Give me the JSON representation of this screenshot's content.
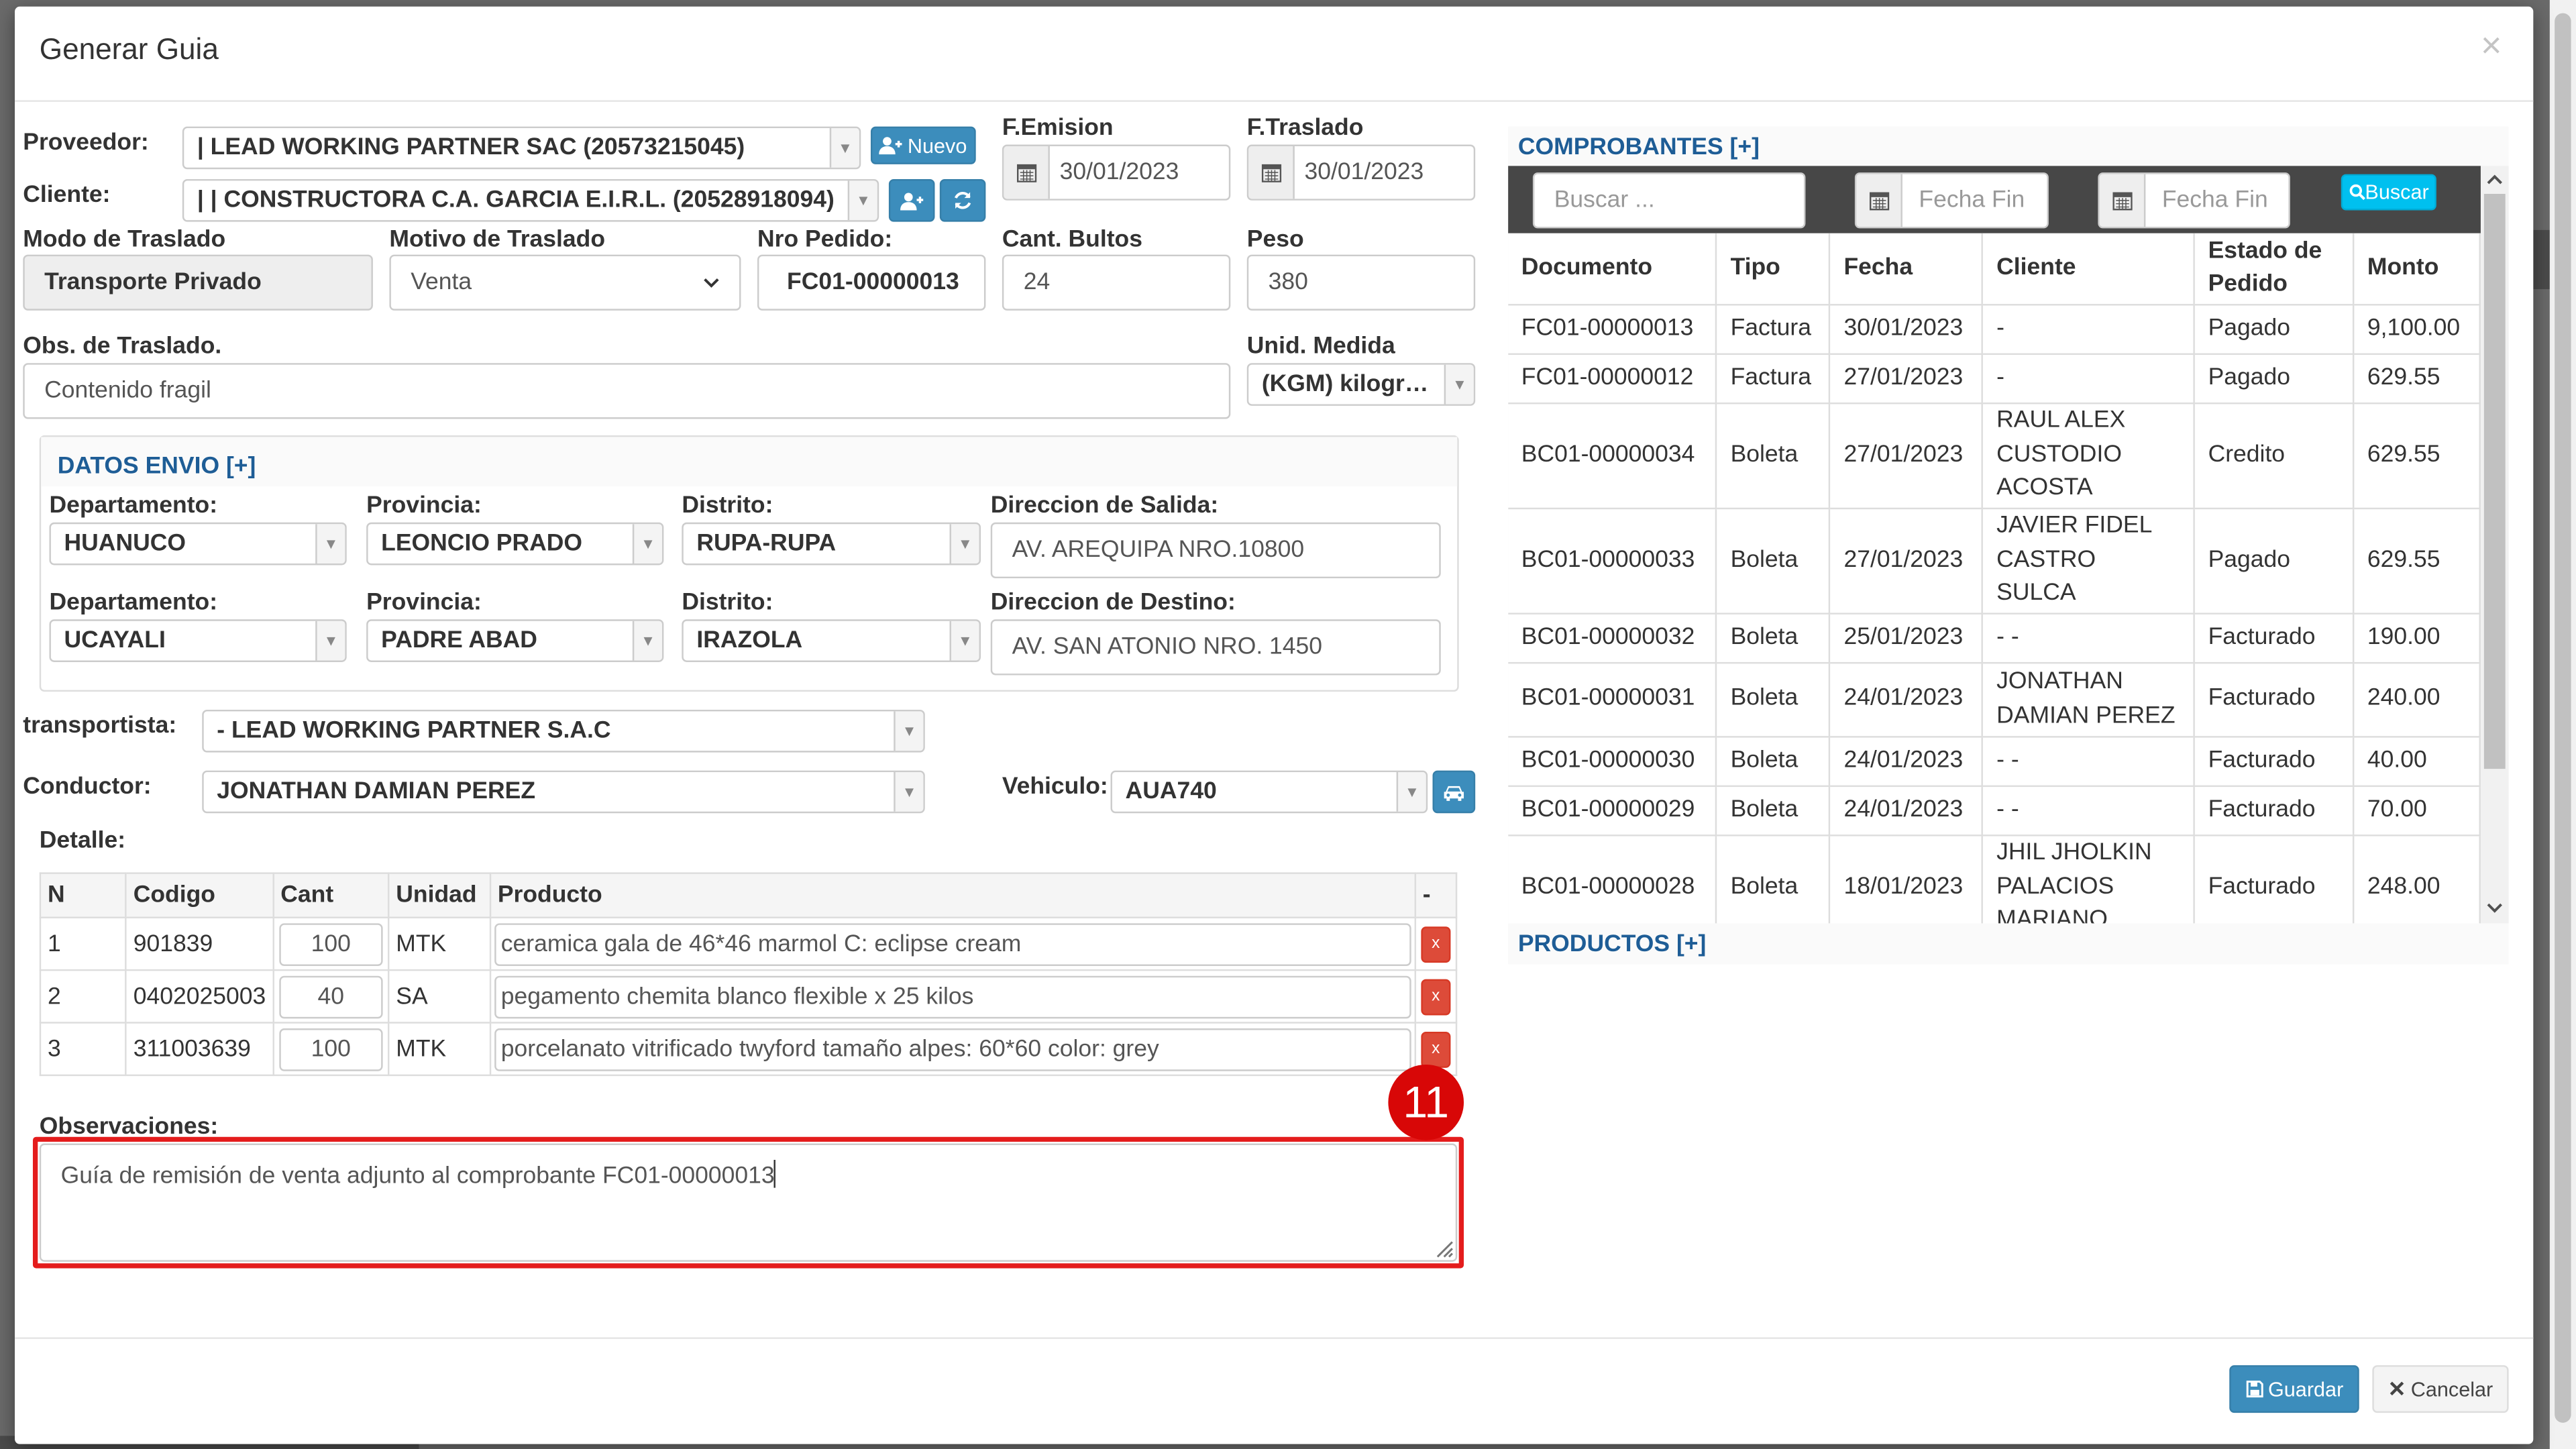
{
  "modal": {
    "title": "Generar Guia",
    "close": "×"
  },
  "form": {
    "proveedor": {
      "label": "Proveedor:",
      "value": "| LEAD WORKING PARTNER SAC (20573215045)",
      "nuevo": "Nuevo"
    },
    "cliente": {
      "label": "Cliente:",
      "value": "| | CONSTRUCTORA C.A. GARCIA E.I.R.L. (20528918094)"
    },
    "f_emision": {
      "label": "F.Emision",
      "value": "30/01/2023"
    },
    "f_traslado": {
      "label": "F.Traslado",
      "value": "30/01/2023"
    },
    "modo": {
      "label": "Modo de Traslado",
      "value": "Transporte Privado"
    },
    "motivo": {
      "label": "Motivo de Traslado",
      "value": "Venta"
    },
    "nro_pedido": {
      "label": "Nro Pedido:",
      "value": "FC01-00000013"
    },
    "bultos": {
      "label": "Cant. Bultos",
      "value": "24"
    },
    "peso": {
      "label": "Peso",
      "value": "380"
    },
    "obs_traslado": {
      "label": "Obs. de Traslado.",
      "value": "Contenido fragil"
    },
    "unidad": {
      "label": "Unid. Medida",
      "value": "(KGM) kilogr…"
    }
  },
  "envio": {
    "title": "DATOS ENVIO [+]",
    "dep_label": "Departamento:",
    "prov_label": "Provincia:",
    "dist_label": "Distrito:",
    "salida_label": "Direccion de Salida:",
    "destino_label": "Direccion de Destino:",
    "origen": {
      "dep": "HUANUCO",
      "prov": "LEONCIO PRADO",
      "dist": "RUPA-RUPA",
      "dir": "AV. AREQUIPA NRO.10800"
    },
    "destino": {
      "dep": "UCAYALI",
      "prov": "PADRE ABAD",
      "dist": "IRAZOLA",
      "dir": "AV. SAN ATONIO NRO. 1450"
    }
  },
  "transportista": {
    "label": "transportista:",
    "value": "- LEAD WORKING PARTNER S.A.C"
  },
  "conductor": {
    "label": "Conductor:",
    "value": "JONATHAN DAMIAN PEREZ"
  },
  "vehiculo": {
    "label": "Vehiculo:",
    "value": "AUA740"
  },
  "detalle": {
    "label": "Detalle:",
    "headers": [
      "N",
      "Codigo",
      "Cant",
      "Unidad",
      "Producto",
      "-"
    ],
    "rows": [
      {
        "n": "1",
        "codigo": "901839",
        "cant": "100",
        "unidad": "MTK",
        "producto": "ceramica gala de 46*46 marmol C: eclipse cream",
        "del": "x"
      },
      {
        "n": "2",
        "codigo": "0402025003",
        "cant": "40",
        "unidad": "SA",
        "producto": "pegamento chemita blanco flexible x 25 kilos",
        "del": "x"
      },
      {
        "n": "3",
        "codigo": "311003639",
        "cant": "100",
        "unidad": "MTK",
        "producto": "porcelanato vitrificado twyford tamaño alpes: 60*60 color: grey",
        "del": "x"
      }
    ]
  },
  "observaciones": {
    "label": "Observaciones:",
    "value": "Guía de remisión de venta adjunto al comprobante FC01-00000013"
  },
  "annotation": {
    "number": "11",
    "color": "#e41c1c"
  },
  "comprobantes": {
    "title": "COMPROBANTES [+]",
    "search_placeholder": "Buscar ...",
    "fecha1_placeholder": "Fecha Fin",
    "fecha2_placeholder": "Fecha Fin",
    "buscar": "Buscar",
    "headers": [
      "Documento",
      "Tipo",
      "Fecha",
      "Cliente",
      "Estado de Pedido",
      "Monto"
    ],
    "rows": [
      {
        "doc": "FC01-00000013",
        "tipo": "Factura",
        "fecha": "30/01/2023",
        "cliente": "-",
        "estado": "Pagado",
        "monto": "9,100.00"
      },
      {
        "doc": "FC01-00000012",
        "tipo": "Factura",
        "fecha": "27/01/2023",
        "cliente": "-",
        "estado": "Pagado",
        "monto": "629.55"
      },
      {
        "doc": "BC01-00000034",
        "tipo": "Boleta",
        "fecha": "27/01/2023",
        "cliente": "RAUL ALEX CUSTODIO ACOSTA",
        "estado": "Credito",
        "monto": "629.55"
      },
      {
        "doc": "BC01-00000033",
        "tipo": "Boleta",
        "fecha": "27/01/2023",
        "cliente": "JAVIER FIDEL CASTRO SULCA",
        "estado": "Pagado",
        "monto": "629.55"
      },
      {
        "doc": "BC01-00000032",
        "tipo": "Boleta",
        "fecha": "25/01/2023",
        "cliente": "- -",
        "estado": "Facturado",
        "monto": "190.00"
      },
      {
        "doc": "BC01-00000031",
        "tipo": "Boleta",
        "fecha": "24/01/2023",
        "cliente": "JONATHAN DAMIAN PEREZ",
        "estado": "Facturado",
        "monto": "240.00"
      },
      {
        "doc": "BC01-00000030",
        "tipo": "Boleta",
        "fecha": "24/01/2023",
        "cliente": "- -",
        "estado": "Facturado",
        "monto": "40.00"
      },
      {
        "doc": "BC01-00000029",
        "tipo": "Boleta",
        "fecha": "24/01/2023",
        "cliente": "- -",
        "estado": "Facturado",
        "monto": "70.00"
      },
      {
        "doc": "BC01-00000028",
        "tipo": "Boleta",
        "fecha": "18/01/2023",
        "cliente": "JHIL JHOLKIN PALACIOS MARIANO",
        "estado": "Facturado",
        "monto": "248.00"
      }
    ]
  },
  "productos": {
    "title": "PRODUCTOS [+]"
  },
  "footer": {
    "guardar": "Guardar",
    "cancelar": "Cancelar"
  }
}
